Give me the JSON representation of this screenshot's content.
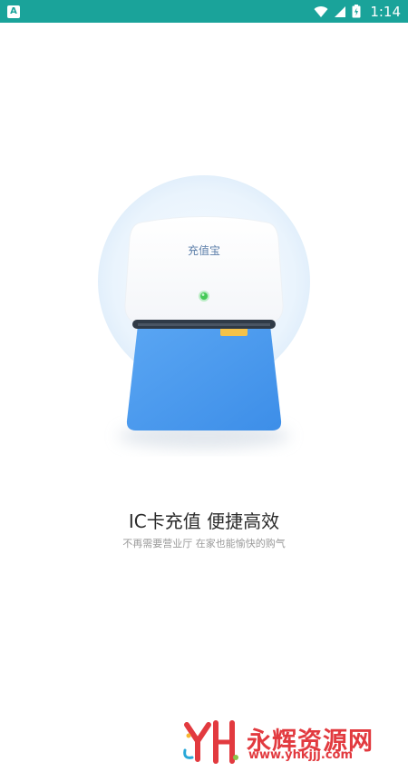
{
  "status_bar": {
    "app_icon_letter": "A",
    "time": "1:14"
  },
  "illustration": {
    "device_label": "充值宝"
  },
  "main": {
    "headline": "IC卡充值 便捷高效",
    "subline": "不再需要营业厅 在家也能愉快的购气"
  },
  "watermark": {
    "logo": "YH",
    "text": "永辉资源网",
    "url": "www.yhkjjj.com"
  },
  "colors": {
    "status_bar": "#1aa39a",
    "card_blue": "#4a9af0",
    "accent_red": "#e23a3f"
  }
}
